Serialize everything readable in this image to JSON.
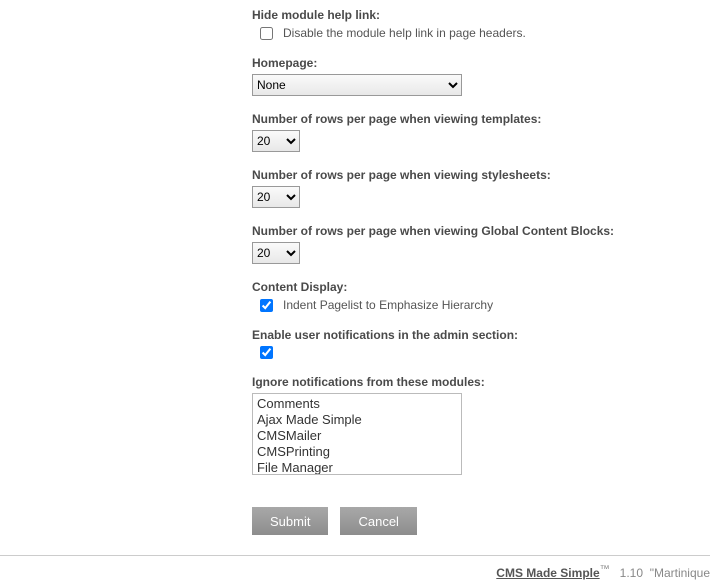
{
  "fields": {
    "hide_help": {
      "label": "Hide module help link:",
      "checkbox_label": "Disable the module help link in page headers.",
      "checked": false
    },
    "homepage": {
      "label": "Homepage:",
      "value": "None"
    },
    "rows_templates": {
      "label": "Number of rows per page when viewing templates:",
      "value": "20"
    },
    "rows_stylesheets": {
      "label": "Number of rows per page when viewing stylesheets:",
      "value": "20"
    },
    "rows_gcb": {
      "label": "Number of rows per page when viewing Global Content Blocks:",
      "value": "20"
    },
    "content_display": {
      "label": "Content Display:",
      "checkbox_label": "Indent Pagelist to Emphasize Hierarchy",
      "checked": true
    },
    "enable_notifications": {
      "label": "Enable user notifications in the admin section:",
      "checked": true
    },
    "ignore_modules": {
      "label": "Ignore notifications from these modules:",
      "options": [
        "Comments",
        "Ajax Made Simple",
        "CMSMailer",
        "CMSPrinting",
        "File Manager"
      ]
    }
  },
  "buttons": {
    "submit": "Submit",
    "cancel": "Cancel"
  },
  "footer": {
    "link_text": "CMS Made Simple",
    "tm": "™",
    "version": "1.10",
    "codename": "\"Martinique"
  }
}
